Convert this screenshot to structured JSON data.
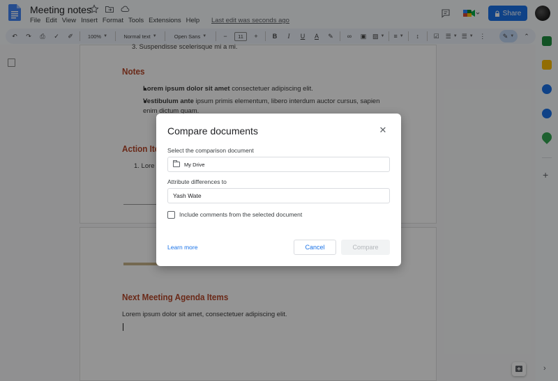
{
  "header": {
    "title": "Meeting notes",
    "menu": [
      "File",
      "Edit",
      "View",
      "Insert",
      "Format",
      "Tools",
      "Extensions",
      "Help"
    ],
    "last_edit": "Last edit was seconds ago",
    "share_label": "Share"
  },
  "toolbar": {
    "zoom": "100%",
    "style": "Normal text",
    "font": "Open Sans",
    "font_size": "11"
  },
  "document": {
    "list_item_3": "3.  Suspendisse scelerisque mi a mi.",
    "notes_heading": "Notes",
    "bullet1_bold": "Lorem ipsum dolor sit amet",
    "bullet1_rest": "consectetuer adipiscing elit.",
    "bullet2_bold": "Vestibulum ante",
    "bullet2_rest": "ipsum primis elementum, libero interdum auctor cursus, sapien",
    "bullet2_line2": "enim dictum quam.",
    "action_heading": "Action Ite",
    "action_item1": "1.  Lore",
    "next_heading": "Next Meeting Agenda Items",
    "next_paragraph": "Lorem ipsum dolor sit amet, consectetuer adipiscing elit."
  },
  "dialog": {
    "title": "Compare documents",
    "close_icon": "close-icon",
    "select_label": "Select the comparison document",
    "select_value": "My Drive",
    "attribute_label": "Attribute differences to",
    "attribute_value": "Yash Wate",
    "checkbox_label": "Include comments from the selected document",
    "checkbox_checked": false,
    "learn_more": "Learn more",
    "cancel_label": "Cancel",
    "compare_label": "Compare"
  },
  "colors": {
    "accent": "#1a73e8",
    "heading": "#b7472a",
    "overlay": "rgba(0,0,0,0.42)"
  }
}
